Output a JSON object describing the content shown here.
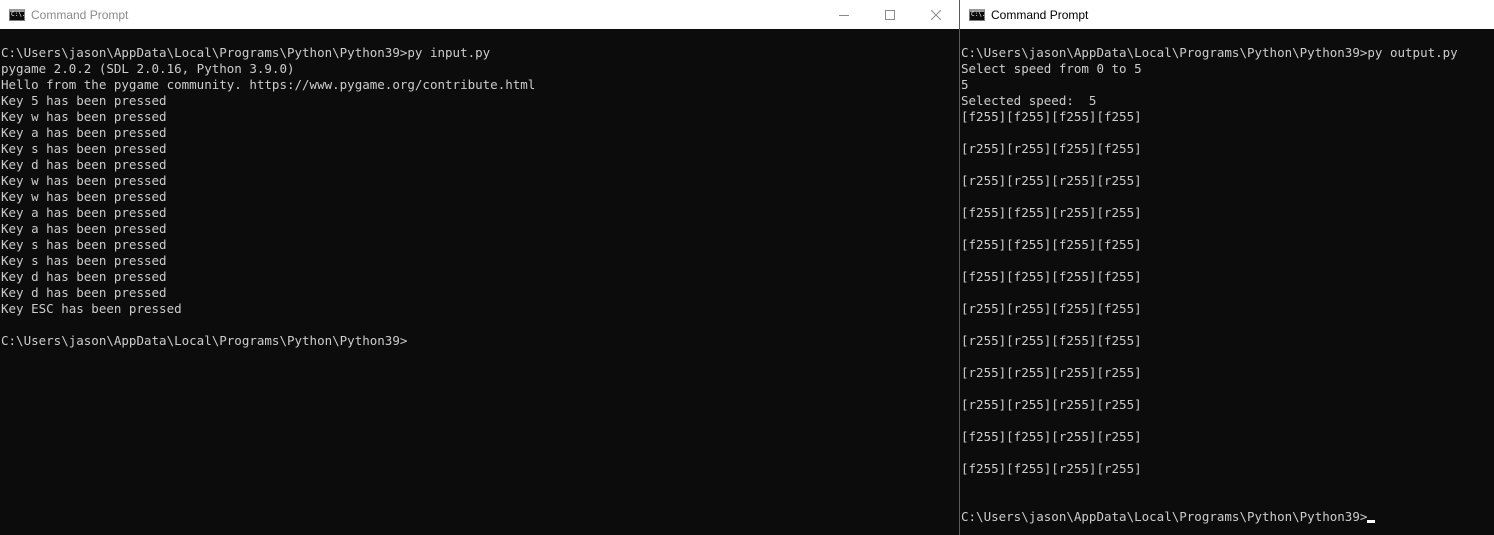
{
  "left_window": {
    "title": "Command Prompt",
    "icon_text": "C:\\.",
    "lines": [
      "C:\\Users\\jason\\AppData\\Local\\Programs\\Python\\Python39>py input.py",
      "pygame 2.0.2 (SDL 2.0.16, Python 3.9.0)",
      "Hello from the pygame community. https://www.pygame.org/contribute.html",
      "Key 5 has been pressed",
      "Key w has been pressed",
      "Key a has been pressed",
      "Key s has been pressed",
      "Key d has been pressed",
      "Key w has been pressed",
      "Key w has been pressed",
      "Key a has been pressed",
      "Key a has been pressed",
      "Key s has been pressed",
      "Key s has been pressed",
      "Key d has been pressed",
      "Key d has been pressed",
      "Key ESC has been pressed",
      "",
      "C:\\Users\\jason\\AppData\\Local\\Programs\\Python\\Python39>"
    ]
  },
  "right_window": {
    "title": "Command Prompt",
    "icon_text": "C:\\.",
    "lines": [
      "C:\\Users\\jason\\AppData\\Local\\Programs\\Python\\Python39>py output.py",
      "Select speed from 0 to 5",
      "5",
      "Selected speed:  5",
      "[f255][f255][f255][f255]",
      "",
      "[r255][r255][f255][f255]",
      "",
      "[r255][r255][r255][r255]",
      "",
      "[f255][f255][r255][r255]",
      "",
      "[f255][f255][f255][f255]",
      "",
      "[f255][f255][f255][f255]",
      "",
      "[r255][r255][f255][f255]",
      "",
      "[r255][r255][f255][f255]",
      "",
      "[r255][r255][r255][r255]",
      "",
      "[r255][r255][r255][r255]",
      "",
      "[f255][f255][r255][r255]",
      "",
      "[f255][f255][r255][r255]",
      "",
      "",
      "C:\\Users\\jason\\AppData\\Local\\Programs\\Python\\Python39>"
    ]
  }
}
